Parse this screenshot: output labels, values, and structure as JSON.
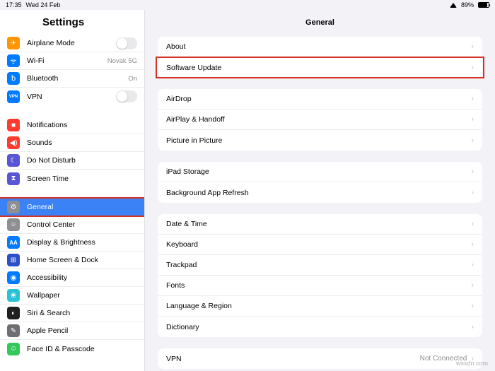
{
  "status": {
    "time": "17:35",
    "date": "Wed 24 Feb",
    "battery": "89%"
  },
  "sidebar": {
    "title": "Settings",
    "groups": [
      [
        {
          "icon": "airplane",
          "bg": "#ff9500",
          "label": "Airplane Mode",
          "ctrl": "switch"
        },
        {
          "icon": "wifi",
          "bg": "#007aff",
          "label": "Wi-Fi",
          "value": "Novak 5G"
        },
        {
          "icon": "bt",
          "bg": "#007aff",
          "label": "Bluetooth",
          "value": "On"
        },
        {
          "icon": "vpn",
          "bg": "#007aff",
          "label": "VPN",
          "ctrl": "switch"
        }
      ],
      [
        {
          "icon": "bell",
          "bg": "#ff3b30",
          "label": "Notifications"
        },
        {
          "icon": "sound",
          "bg": "#ff3b30",
          "label": "Sounds"
        },
        {
          "icon": "moon",
          "bg": "#5856d6",
          "label": "Do Not Disturb"
        },
        {
          "icon": "hourglass",
          "bg": "#5856d6",
          "label": "Screen Time"
        }
      ],
      [
        {
          "icon": "gear",
          "bg": "#8e8e93",
          "label": "General",
          "selected": true,
          "highlight": true
        },
        {
          "icon": "sliders",
          "bg": "#8e8e93",
          "label": "Control Center"
        },
        {
          "icon": "aa",
          "bg": "#007aff",
          "label": "Display & Brightness"
        },
        {
          "icon": "grid",
          "bg": "#2b50c7",
          "label": "Home Screen & Dock"
        },
        {
          "icon": "person",
          "bg": "#007aff",
          "label": "Accessibility"
        },
        {
          "icon": "flower",
          "bg": "#29c2d6",
          "label": "Wallpaper"
        },
        {
          "icon": "siri",
          "bg": "#1f1f1f",
          "label": "Siri & Search"
        },
        {
          "icon": "pencil",
          "bg": "#6e6e73",
          "label": "Apple Pencil"
        },
        {
          "icon": "faceid",
          "bg": "#34c759",
          "label": "Face ID & Passcode"
        }
      ]
    ]
  },
  "content": {
    "title": "General",
    "sections": [
      [
        {
          "label": "About"
        },
        {
          "label": "Software Update",
          "highlight": true
        }
      ],
      [
        {
          "label": "AirDrop"
        },
        {
          "label": "AirPlay & Handoff"
        },
        {
          "label": "Picture in Picture"
        }
      ],
      [
        {
          "label": "iPad Storage"
        },
        {
          "label": "Background App Refresh"
        }
      ],
      [
        {
          "label": "Date & Time"
        },
        {
          "label": "Keyboard"
        },
        {
          "label": "Trackpad"
        },
        {
          "label": "Fonts"
        },
        {
          "label": "Language & Region"
        },
        {
          "label": "Dictionary"
        }
      ],
      [
        {
          "label": "VPN",
          "value": "Not Connected"
        }
      ]
    ]
  },
  "watermark": "wsxdn.com",
  "icons": {
    "airplane": "✈",
    "wifi": "ᯤ",
    "bt": "␢",
    "vpn": "VPN",
    "bell": "■",
    "sound": "◀)",
    "moon": "☾",
    "hourglass": "⧗",
    "gear": "⚙",
    "sliders": "⌾",
    "aa": "AA",
    "grid": "⊞",
    "person": "◉",
    "flower": "❀",
    "siri": "◐",
    "pencil": "✎",
    "faceid": "☺"
  }
}
